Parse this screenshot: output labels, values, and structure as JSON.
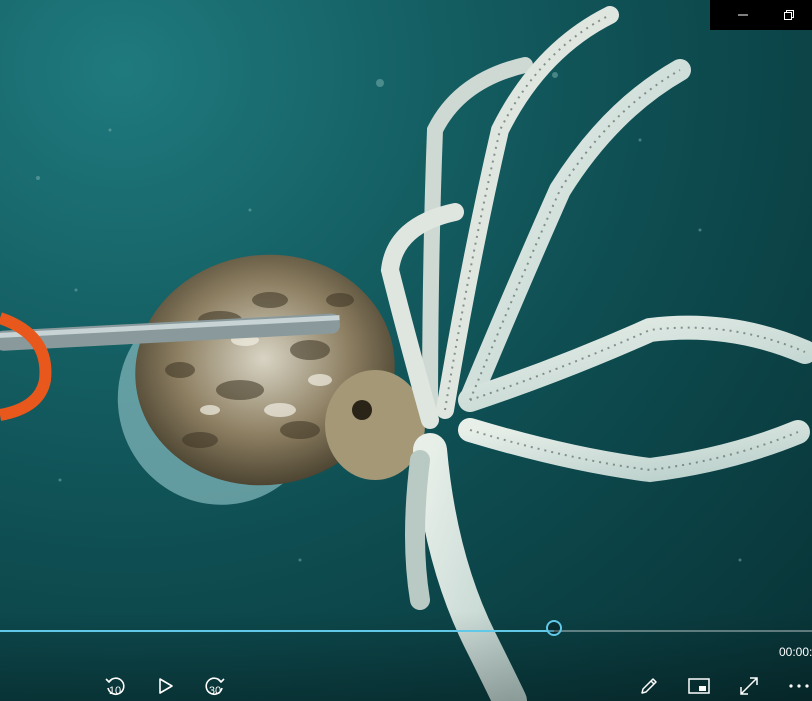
{
  "window": {
    "minimize_icon": "minimize-icon",
    "restore_icon": "restore-icon"
  },
  "player": {
    "progress": 0.682,
    "time_visible": "00:00:",
    "skip_back_label": "10",
    "skip_forward_label": "30",
    "icons": {
      "skip_back": "rewind-10-icon",
      "play": "play-icon",
      "skip_forward": "forward-30-icon",
      "edit": "pencil-icon",
      "mini_view": "mini-view-icon",
      "fullscreen": "fullscreen-icon",
      "more": "more-icon"
    },
    "accent": "#62c8e8"
  }
}
